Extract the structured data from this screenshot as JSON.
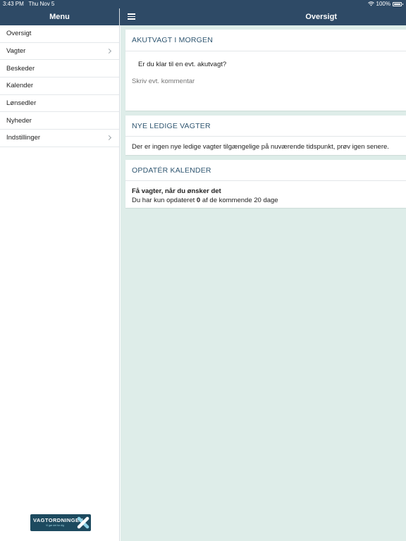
{
  "statusbar": {
    "time": "3:43 PM",
    "date": "Thu Nov 5",
    "battery": "100%"
  },
  "sidebar": {
    "title": "Menu",
    "items": [
      {
        "label": "Oversigt",
        "chevron": false
      },
      {
        "label": "Vagter",
        "chevron": true
      },
      {
        "label": "Beskeder",
        "chevron": false
      },
      {
        "label": "Kalender",
        "chevron": false
      },
      {
        "label": "Lønsedler",
        "chevron": false
      },
      {
        "label": "Nyheder",
        "chevron": false
      },
      {
        "label": "Indstillinger",
        "chevron": true
      }
    ],
    "logo": {
      "text": "VAGTORDNINGEN",
      "tagline": "Vi gør det for dig"
    }
  },
  "topbar": {
    "title": "Oversigt"
  },
  "cards": {
    "akut": {
      "header": "AKUTVAGT I MORGEN",
      "question": "Er du klar til en evt. akutvagt?",
      "comment_placeholder": "Skriv evt. kommentar"
    },
    "ledige": {
      "header": "NYE LEDIGE VAGTER",
      "text": "Der er ingen nye ledige vagter tilgængelige på nuværende tidspunkt, prøv igen senere."
    },
    "kalender": {
      "header": "OPDATÉR KALENDER",
      "title": "Få vagter, når du ønsker det",
      "text_pre": "Du har kun opdateret ",
      "count": "0",
      "text_post": " af de kommende 20 dage"
    }
  },
  "colors": {
    "navbar": "#2e4a66",
    "background": "#deede9",
    "header_text": "#2e5570"
  }
}
